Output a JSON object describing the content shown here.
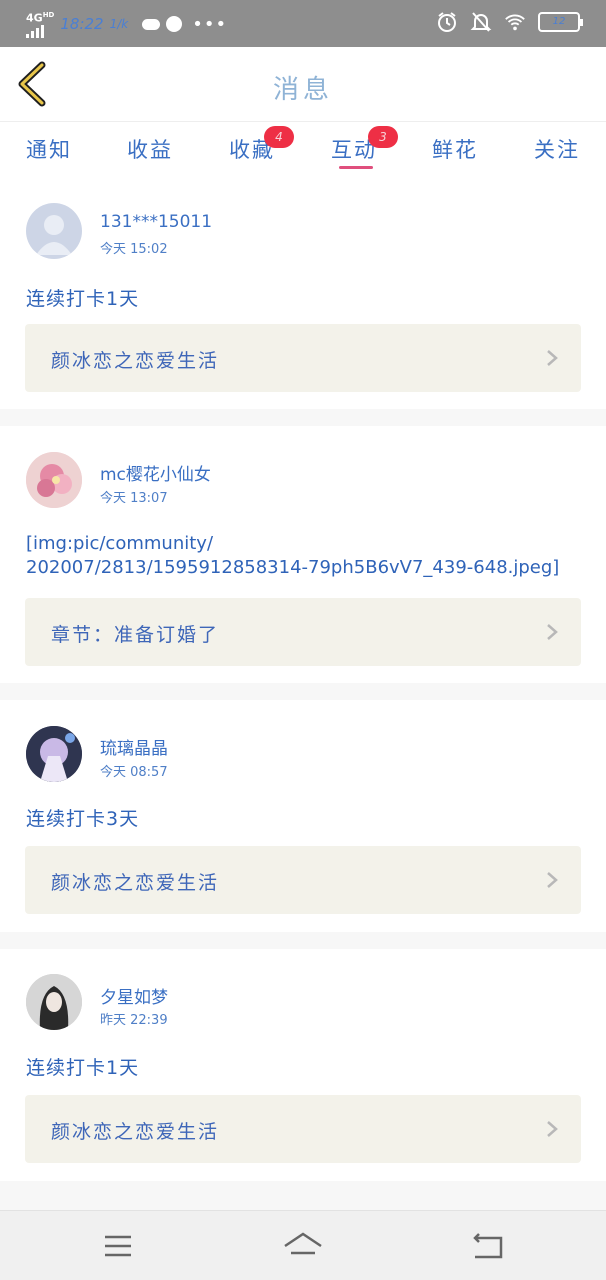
{
  "status_bar": {
    "network": "4G",
    "network_sup": "HD",
    "time": "18:22",
    "extra": "1/k",
    "battery": "12"
  },
  "header": {
    "title": "消息"
  },
  "tabs": [
    {
      "label": "通知"
    },
    {
      "label": "收益"
    },
    {
      "label": "收藏",
      "badge": "4"
    },
    {
      "label": "互动",
      "badge": "3",
      "active": true
    },
    {
      "label": "鲜花"
    },
    {
      "label": "关注"
    }
  ],
  "messages": [
    {
      "user": "131***15011",
      "time": "今天 15:02",
      "content": "连续打卡1天",
      "source": "颜冰恋之恋爱生活"
    },
    {
      "user": "mc樱花小仙女",
      "time": "今天 13:07",
      "content_line1": "[img:pic/community/",
      "content_line2": "202007/2813/1595912858314-79ph5B6vV7_439-648.jpeg]",
      "source": "章节：准备订婚了"
    },
    {
      "user": "琉璃晶晶",
      "time": "今天 08:57",
      "content": "连续打卡3天",
      "source": "颜冰恋之恋爱生活"
    },
    {
      "user": "夕星如梦",
      "time": "昨天 22:39",
      "content": "连续打卡1天",
      "source": "颜冰恋之恋爱生活"
    }
  ],
  "colors": {
    "accent_text": "#3a6fc3",
    "badge": "#ee2f45",
    "indicator": "#e04f7d",
    "card_source_bg": "#f3f2ea",
    "statusbar_bg": "#8e8e8e"
  },
  "icons": {
    "back": "back-chevron-icon",
    "chevron": "chevron-right-icon",
    "menu": "menu-icon",
    "home": "home-icon",
    "return": "return-icon"
  }
}
